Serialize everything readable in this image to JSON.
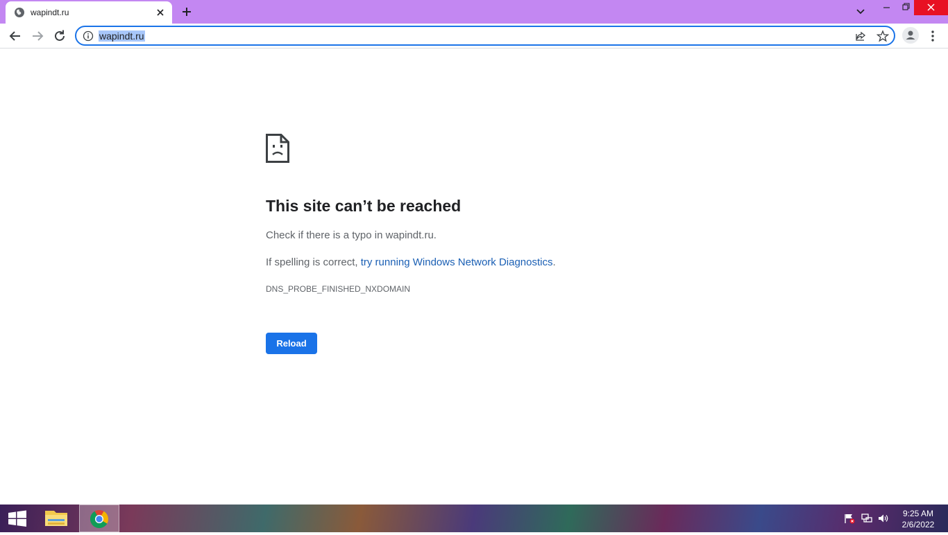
{
  "browser": {
    "tab": {
      "title": "wapindt.ru"
    },
    "address_bar": {
      "url": "wapindt.ru"
    }
  },
  "error_page": {
    "title": "This site can’t be reached",
    "line1": "Check if there is a typo in wapindt.ru.",
    "line2_prefix": "If spelling is correct, ",
    "line2_link": "try running Windows Network Diagnostics",
    "line2_suffix": ".",
    "error_code": "DNS_PROBE_FINISHED_NXDOMAIN",
    "reload_label": "Reload"
  },
  "taskbar": {
    "clock_time": "9:25 AM",
    "clock_date": "2/6/2022"
  },
  "colors": {
    "tab_strip": "#c387f2",
    "accent": "#1a73e8",
    "close_button": "#e81123"
  },
  "icons": [
    "globe-icon",
    "close-icon",
    "plus-icon",
    "chevron-down-icon",
    "minimize-icon",
    "restore-icon",
    "back-icon",
    "forward-icon",
    "reload-icon",
    "info-icon",
    "share-icon",
    "star-icon",
    "profile-icon",
    "menu-icon",
    "sad-page-icon",
    "windows-logo-icon",
    "file-explorer-icon",
    "chrome-icon",
    "flag-icon",
    "network-icon",
    "volume-icon"
  ]
}
